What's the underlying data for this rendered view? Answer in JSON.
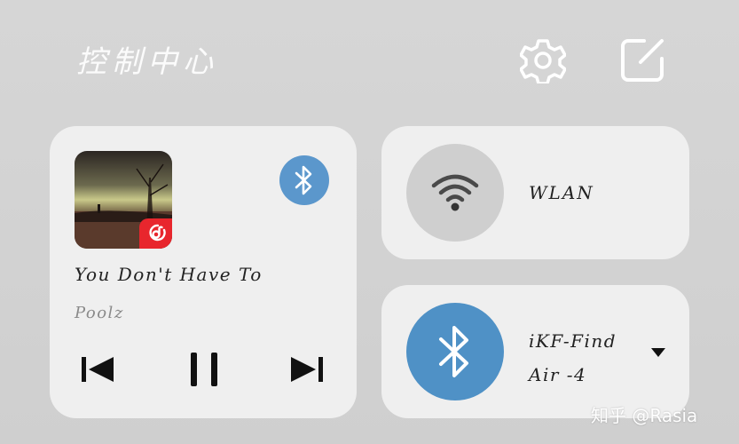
{
  "header": {
    "title": "控制中心",
    "settings_icon": "gear-icon",
    "edit_icon": "edit-icon"
  },
  "media": {
    "song_title": "You Don't Have To",
    "artist": "Poolz",
    "app_badge_icon": "netease-music-icon",
    "output_icon": "bluetooth-icon",
    "controls": [
      "previous-icon",
      "pause-icon",
      "next-icon"
    ]
  },
  "wlan": {
    "label": "WLAN",
    "icon": "wifi-icon"
  },
  "bluetooth": {
    "device_line1": "iKF-Find",
    "device_line2": "Air -4",
    "icon": "bluetooth-icon",
    "dropdown_icon": "caret-down-icon"
  },
  "watermark": "知乎 @Rasia",
  "colors": {
    "background": "#d4d4d4",
    "card": "#efefef",
    "bluetooth_accent": "#4f91c6",
    "app_badge": "#e8262d",
    "wifi_circle": "#cfcfcf"
  }
}
